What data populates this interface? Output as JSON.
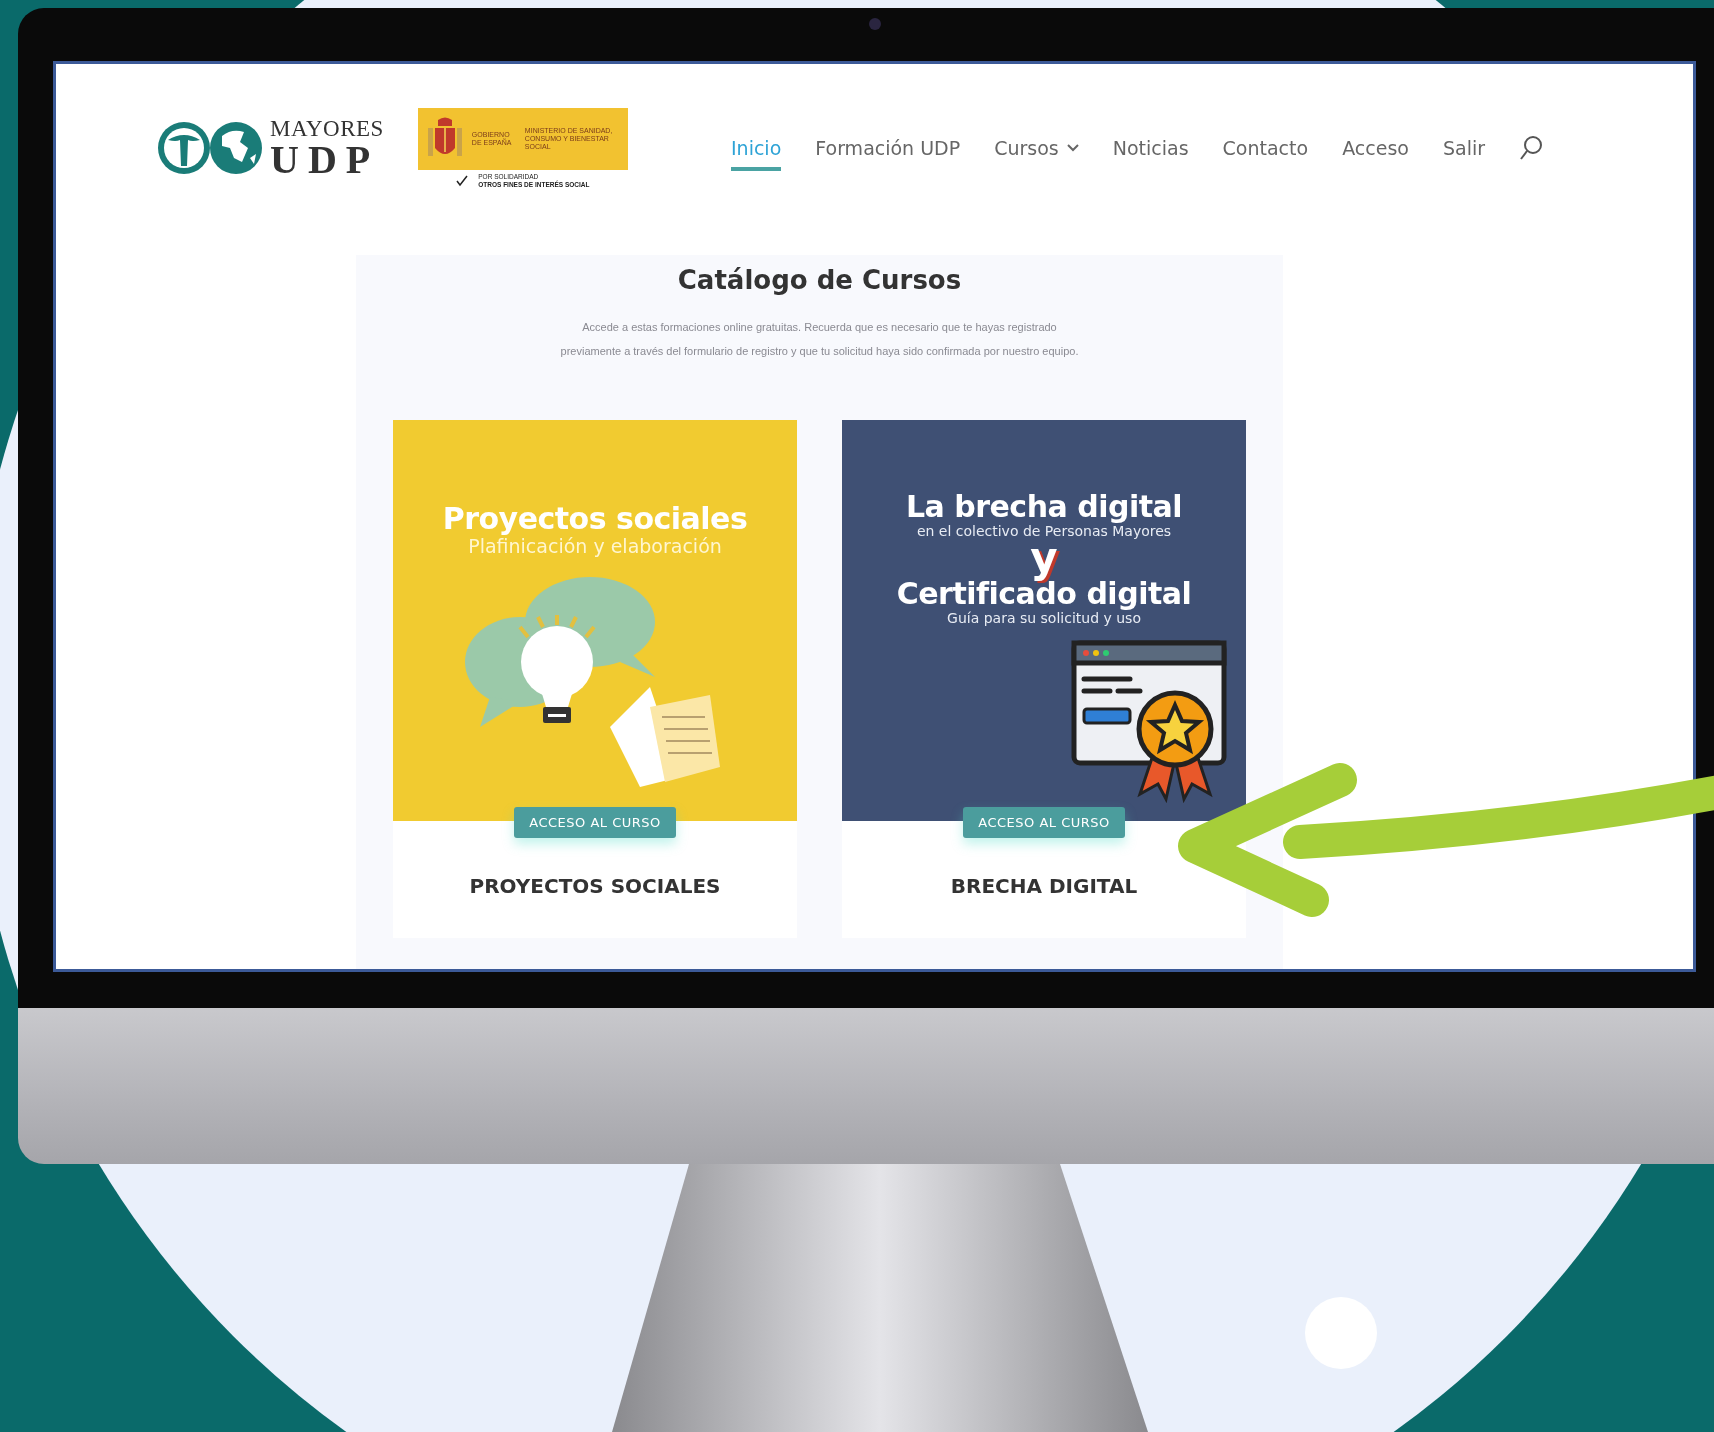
{
  "logo": {
    "top": "MAYORES",
    "bottom": "UDP"
  },
  "gov_logo": {
    "government": "GOBIERNO DE ESPAÑA",
    "ministry": "MINISTERIO DE SANIDAD, CONSUMO Y BIENESTAR SOCIAL",
    "tagline": "POR SOLIDARIDAD",
    "tagline_bold": "OTROS FINES DE INTERÉS SOCIAL"
  },
  "nav": {
    "items": [
      {
        "label": "Inicio",
        "selected": true,
        "dropdown": false
      },
      {
        "label": "Formación UDP",
        "selected": false,
        "dropdown": false
      },
      {
        "label": "Cursos",
        "selected": false,
        "dropdown": true
      },
      {
        "label": "Noticias",
        "selected": false,
        "dropdown": false
      },
      {
        "label": "Contacto",
        "selected": false,
        "dropdown": false
      },
      {
        "label": "Acceso",
        "selected": false,
        "dropdown": false
      },
      {
        "label": "Salir",
        "selected": false,
        "dropdown": false
      }
    ]
  },
  "catalog": {
    "title": "Catálogo de Cursos",
    "description": "Accede a estas formaciones online gratuitas. Recuerda que es necesario que te hayas registrado previamente a través del formulario de registro y que tu solicitud haya sido confirmada por nuestro equipo."
  },
  "courses": [
    {
      "kind": "social",
      "banner_lines": [
        "Proyectos sociales",
        "Plafinicación y elaboración"
      ],
      "button": "ACCESO AL CURSO",
      "title": "PROYECTOS SOCIALES"
    },
    {
      "kind": "digital",
      "banner_lines": [
        "La brecha digital",
        "en el colectivo de Personas Mayores",
        "y",
        "Certificado digital",
        "Guía para su solicitud y uso"
      ],
      "button": "ACCESO AL CURSO",
      "title": "BRECHA DIGITAL"
    }
  ]
}
